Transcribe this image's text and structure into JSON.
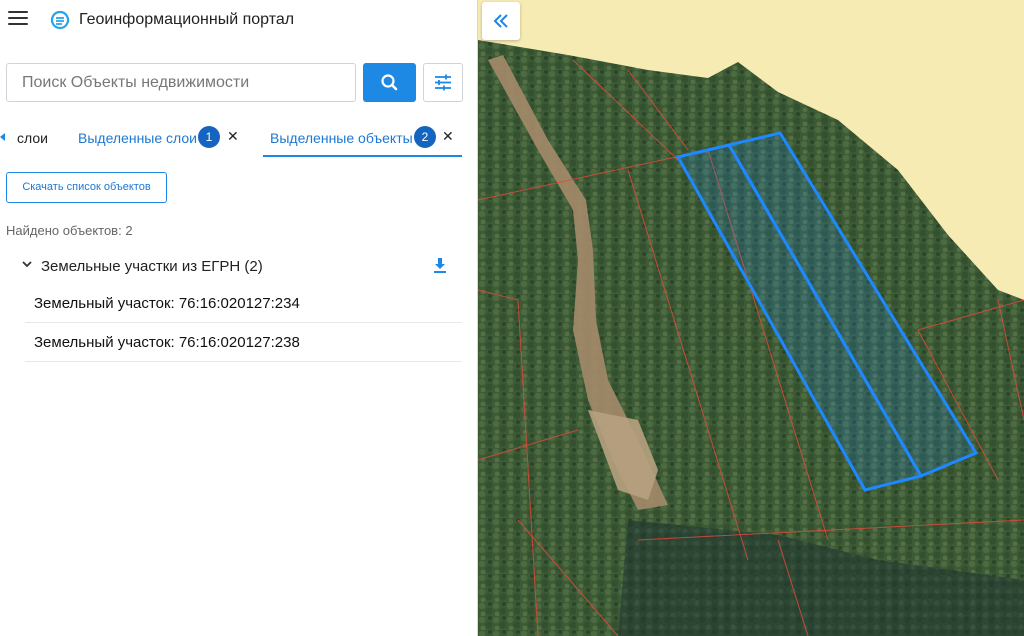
{
  "app": {
    "title": "Геоинформационный портал"
  },
  "search": {
    "placeholder": "Поиск Объекты недвижимости"
  },
  "tabs": {
    "layers_label": "слои",
    "selected_layers": {
      "label": "Выделенные слои",
      "count": "1"
    },
    "selected_objects": {
      "label": "Выделенные объекты",
      "count": "2"
    }
  },
  "results": {
    "download_label": "Скачать список объектов",
    "found_text": "Найдено объектов: 2",
    "group": {
      "label": "Земельные участки из ЕГРН (2)",
      "items": [
        {
          "label": "Земельный участок: 76:16:020127:234"
        },
        {
          "label": "Земельный участок: 76:16:020127:238"
        }
      ]
    }
  },
  "colors": {
    "accent": "#1e88e5",
    "badge": "#1565c0",
    "parcel_outline": "#e04a3a",
    "selection_outline": "#1e88ff",
    "water": "#f7ebb4"
  },
  "icons": {
    "menu": "menu-icon",
    "logo": "portal-logo-icon",
    "search": "search-icon",
    "filter": "tune-icon",
    "close": "close-icon",
    "chevron": "chevron-down-icon",
    "download": "download-icon",
    "collapse": "double-chevron-left-icon"
  }
}
